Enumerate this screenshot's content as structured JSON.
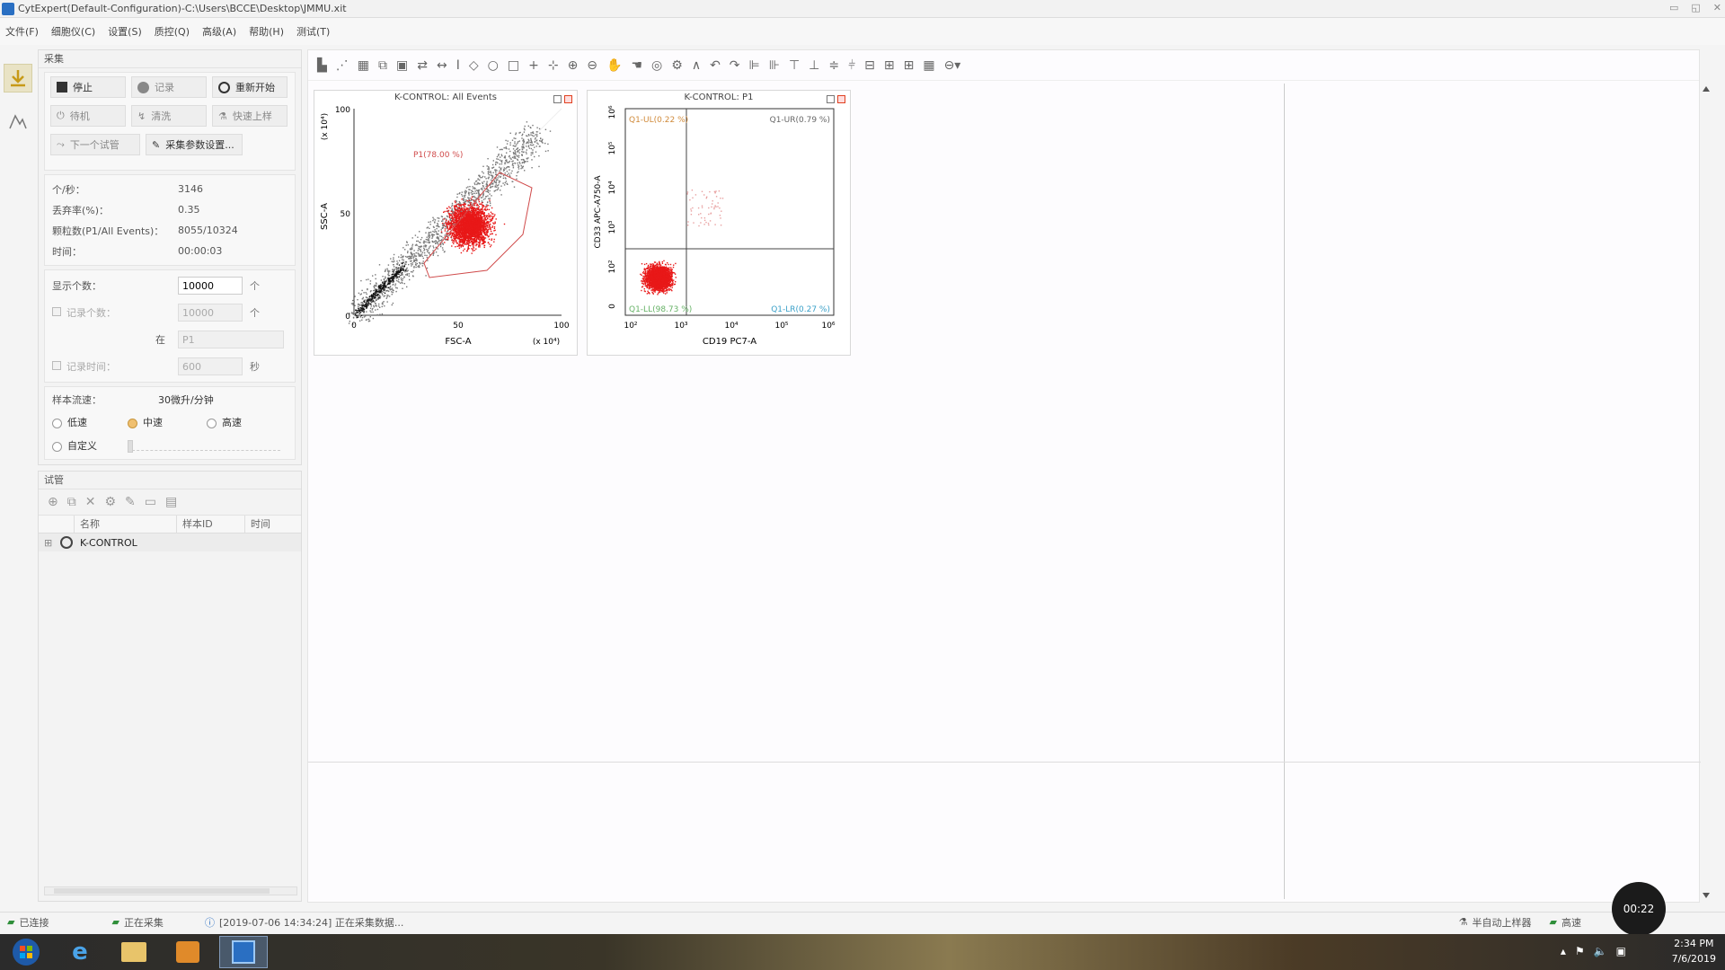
{
  "window": {
    "title": "CytExpert(Default-Configuration)-C:\\Users\\BCCE\\Desktop\\JMMU.xit"
  },
  "menu": [
    "文件(F)",
    "细胞仪(C)",
    "设置(S)",
    "质控(Q)",
    "高级(A)",
    "帮助(H)",
    "测试(T)"
  ],
  "acquisition": {
    "header": "采集",
    "buttons": {
      "stop": "停止",
      "record": "记录",
      "restart": "重新开始",
      "standby": "待机",
      "clean": "清洗",
      "fast_load": "快速上样",
      "next_tube": "下一个试管",
      "acq_settings": "采集参数设置..."
    },
    "stats": [
      {
        "label": "个/秒：",
        "value": "3146"
      },
      {
        "label": "丢弃率(%)：",
        "value": "0.35"
      },
      {
        "label": "颗粒数(P1/All Events)：",
        "value": "8055/10324"
      },
      {
        "label": "时间：",
        "value": "00:00:03"
      }
    ],
    "display_count": {
      "label": "显示个数：",
      "value": "10000",
      "unit": "个"
    },
    "record_count": {
      "label": "记录个数：",
      "value": "10000",
      "unit": "个"
    },
    "in_gate": {
      "label": "在",
      "value": "P1"
    },
    "record_time": {
      "label": "记录时间：",
      "value": "600",
      "unit": "秒"
    },
    "flow": {
      "label": "样本流速：",
      "value": "30微升/分钟",
      "options": [
        "低速",
        "中速",
        "高速",
        "自定义"
      ],
      "selected": "中速"
    }
  },
  "tubes": {
    "header": "试管",
    "columns": [
      "名称",
      "样本ID",
      "时间"
    ],
    "rows": [
      {
        "name": "K-CONTROL"
      }
    ]
  },
  "plots": [
    {
      "title": "K-CONTROL: All Events",
      "gate": "P1(78.00 %)",
      "xlabel": "FSC-A",
      "ylabel": "SSC-A",
      "xscale": "(x 10⁴)",
      "yscale": "(x 10⁴)",
      "xticks": [
        "0",
        "50",
        "100"
      ],
      "yticks": [
        "0",
        "50",
        "100"
      ]
    },
    {
      "title": "K-CONTROL: P1",
      "xlabel": "CD19 PC7-A",
      "ylabel": "CD33 APC-A750-A",
      "quadrants": {
        "ul": "Q1-UL(0.22 %)",
        "ur": "Q1-UR(0.79 %)",
        "ll": "Q1-LL(98.73 %)",
        "lr": "Q1-LR(0.27 %)"
      },
      "xticks": [
        "10²",
        "10³",
        "10⁴",
        "10⁵",
        "10⁶"
      ],
      "yticks": [
        "0",
        "10²",
        "10³",
        "10⁴",
        "10⁵",
        "10⁶"
      ]
    }
  ],
  "status": {
    "connected": "已连接",
    "acquiring": "正在采集",
    "message": "[2019-07-06 14:34:24] 正在采集数据...",
    "autoload": "半自动上样器",
    "speed": "高速"
  },
  "timer": "00:22",
  "clock": {
    "time": "2:34 PM",
    "date": "7/6/2019"
  }
}
